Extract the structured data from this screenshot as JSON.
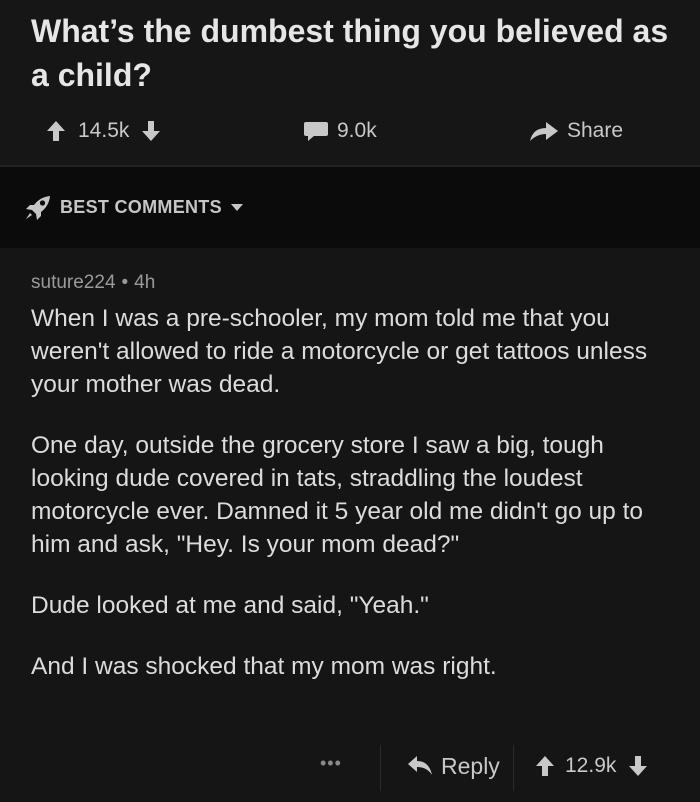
{
  "post": {
    "title": "What’s the dumbest thing you believed as a child?",
    "upvotes": "14.5k",
    "comments": "9.0k",
    "share_label": "Share"
  },
  "sort": {
    "label": "BEST COMMENTS"
  },
  "comment": {
    "author": "suture224",
    "separator": "•",
    "age": "4h",
    "paragraphs": [
      "When I was a pre-schooler, my mom told me that you weren't allowed to ride a motorcycle or get tattoos unless your mother was dead.",
      "One day, outside the grocery store I saw a big, tough looking dude covered in tats, straddling the loudest motorcycle ever. Damned it 5 year old me didn't go up to him and ask, \"Hey. Is your mom dead?\"",
      "Dude looked at me and said, \"Yeah.\"",
      "And I was shocked that my mom was right."
    ],
    "more_label": "•••",
    "reply_label": "Reply",
    "score": "12.9k"
  },
  "colors": {
    "background": "#151515",
    "sort_bar": "#0b0b0b",
    "text": "#dcdcdc",
    "muted": "#9a9a9a"
  },
  "icons": [
    "up-arrow-icon",
    "down-arrow-icon",
    "comment-bubble-icon",
    "share-arrow-icon",
    "rocket-icon",
    "caret-down-icon",
    "reply-arrow-icon",
    "more-dots-icon"
  ]
}
